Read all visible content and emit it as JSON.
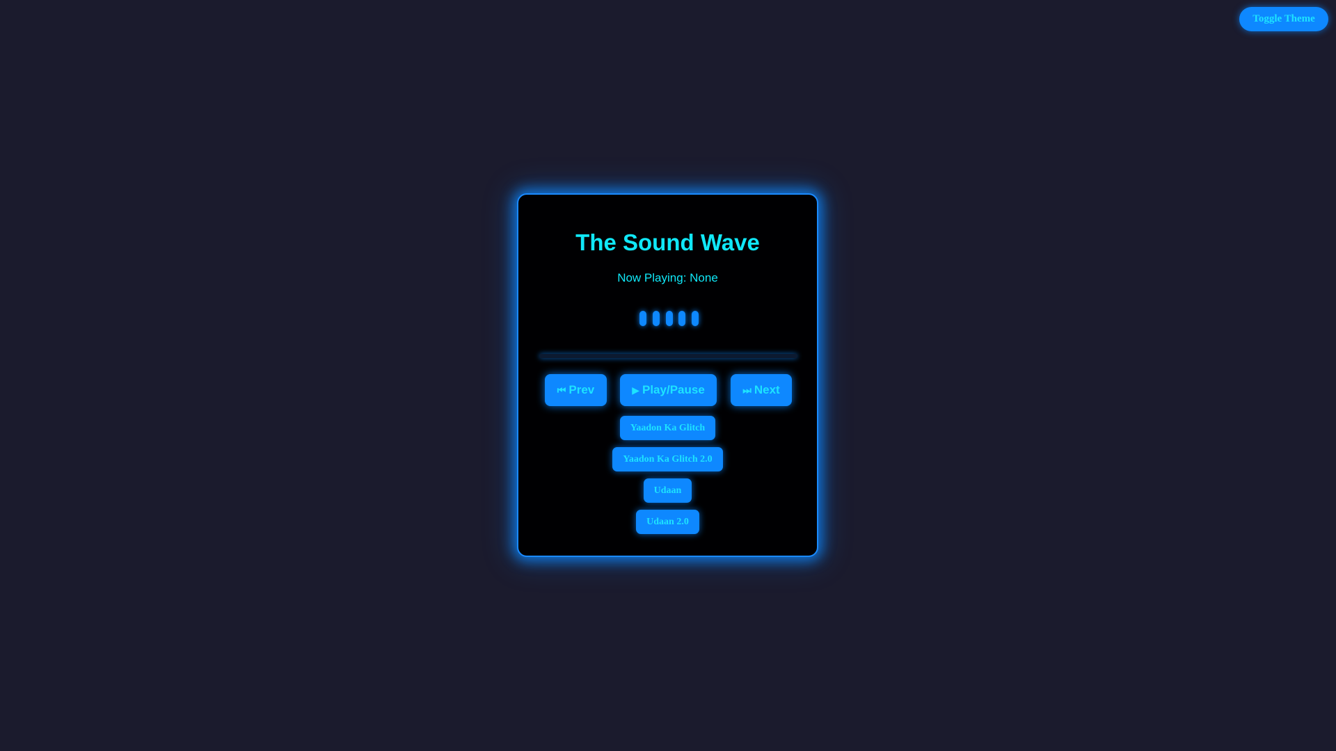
{
  "theme_toggle": {
    "label": "Toggle Theme"
  },
  "player": {
    "title": "The Sound Wave",
    "now_playing_label": "Now Playing:",
    "now_playing_value": "None",
    "progress_fraction": 0,
    "controls": {
      "prev_icon": "⏮",
      "prev_label": "Prev",
      "play_icon": "▶",
      "play_label": "Play/Pause",
      "next_icon": "⏭",
      "next_label": "Next"
    },
    "tracks": [
      {
        "label": "Yaadon Ka Glitch"
      },
      {
        "label": "Yaadon Ka Glitch 2.0"
      },
      {
        "label": "Udaan"
      },
      {
        "label": "Udaan 2.0"
      }
    ]
  },
  "colors": {
    "background": "#1b1b2d",
    "panel": "#000002",
    "accent": "#0e88ff",
    "text": "#10e8f8"
  }
}
